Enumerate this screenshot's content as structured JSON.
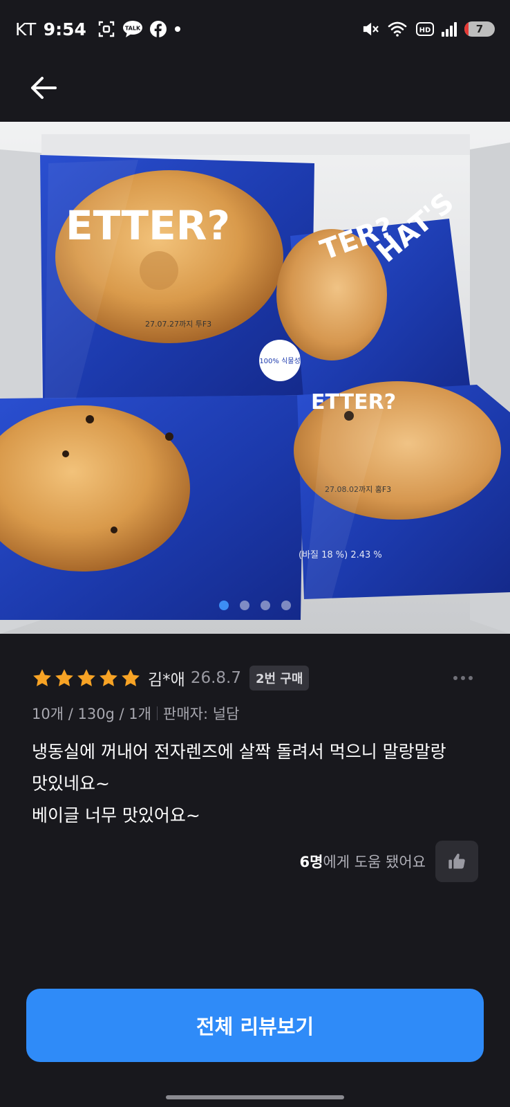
{
  "status_bar": {
    "carrier": "KT",
    "time": "9:54",
    "left_icons": [
      "screenshot-icon",
      "kakaotalk-icon",
      "facebook-icon",
      "dot-icon"
    ],
    "kakao_label": "TALK",
    "right_icons": [
      "mute-vibrate-icon",
      "wifi-icon",
      "hd-icon",
      "signal-icon",
      "battery-icon"
    ],
    "hd_label": "HD",
    "battery_level": "7"
  },
  "nav": {
    "back_icon": "arrow-left-icon"
  },
  "photo": {
    "slide_count": 4,
    "active_index": 0,
    "package_texts": {
      "headline_1": "ETTER?",
      "headline_2": "HAT'S",
      "headline_3": "TER?",
      "headline_4": "ETTER?",
      "expiry_1": "27.07.27까지 투F3",
      "expiry_2": "27.08.02까지 홍F3",
      "nutrition": "(바질 18 %) 2.43 %",
      "badge": "100% 식물성"
    },
    "colors": {
      "package_blue": "#1f3fb8",
      "bagel": "#d79a4e",
      "box": "#dcdde0"
    }
  },
  "review": {
    "rating": 5,
    "max_rating": 5,
    "star_color": "#f7a325",
    "reviewer": "김*애",
    "date": "26.8.7",
    "purchase_badge": "2번 구매",
    "option_text": "10개 / 130g / 1개",
    "seller_text": "판매자: 널담",
    "body_lines": [
      "냉동실에 꺼내어 전자렌즈에 살짝 돌려서 먹으니 말랑말랑",
      "맛있네요~",
      "베이글 너무 맛있어요~"
    ],
    "helpful_count": "6명",
    "helpful_suffix": "에게 도움 됐어요"
  },
  "all_reviews_button": {
    "label": "전체 리뷰보기",
    "color": "#2f8bf8"
  }
}
